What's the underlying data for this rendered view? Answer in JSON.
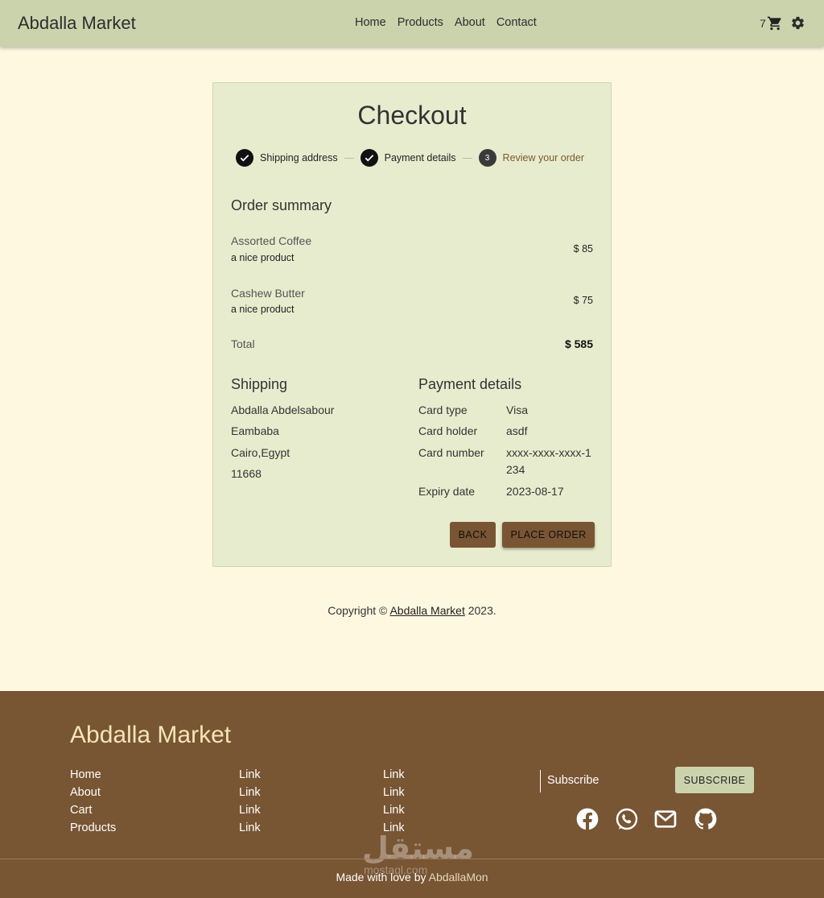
{
  "header": {
    "brand": "Abdalla Market",
    "nav": [
      "Home",
      "Products",
      "About",
      "Contact"
    ],
    "cart_count": "7"
  },
  "checkout": {
    "title": "Checkout",
    "steps": [
      {
        "label": "Shipping address",
        "state": "done"
      },
      {
        "label": "Payment details",
        "state": "done"
      },
      {
        "label": "Review your order",
        "state": "active",
        "number": "3"
      }
    ],
    "order_summary_title": "Order summary",
    "items": [
      {
        "name": "Assorted Coffee",
        "desc": "a nice product",
        "price": "$ 85"
      },
      {
        "name": "Cashew Butter",
        "desc": "a nice product",
        "price": "$ 75"
      }
    ],
    "total_label": "Total",
    "total_value": "$ 585",
    "shipping_title": "Shipping",
    "shipping_lines": [
      "Abdalla Abdelsabour",
      "Eambaba",
      "Cairo,Egypt",
      "11668"
    ],
    "payment_title": "Payment details",
    "payment": [
      {
        "label": "Card type",
        "value": "Visa"
      },
      {
        "label": "Card holder",
        "value": "asdf"
      },
      {
        "label": "Card number",
        "value": "xxxx-xxxx-xxxx-1234"
      },
      {
        "label": "Expiry date",
        "value": "2023-08-17"
      }
    ],
    "back_label": "BACK",
    "place_label": "PLACE ORDER"
  },
  "copyright": {
    "prefix": "Copyright ©",
    "link": "Abdalla Market",
    "suffix": "2023."
  },
  "footer": {
    "brand": "Abdalla Market",
    "col1": [
      "Home",
      "About",
      "Cart",
      "Products"
    ],
    "col2": [
      "Link",
      "Link",
      "Link",
      "Link"
    ],
    "col3": [
      "Link",
      "Link",
      "Link",
      "Link"
    ],
    "subscribe_label": "Subscribe",
    "subscribe_button": "SUBSCRIBE",
    "socials": [
      "facebook-icon",
      "whatsapp-icon",
      "mail-icon",
      "github-icon"
    ],
    "made_prefix": "Made with love by",
    "made_author": "AbdallaMon",
    "watermark": "مستقل",
    "watermark_sub": "mostaql.com"
  },
  "colors": {
    "page_bg": "#fef8e1",
    "navbar": "#cbd3ad",
    "card": "#e8ecce",
    "accent_brown": "#785533"
  }
}
